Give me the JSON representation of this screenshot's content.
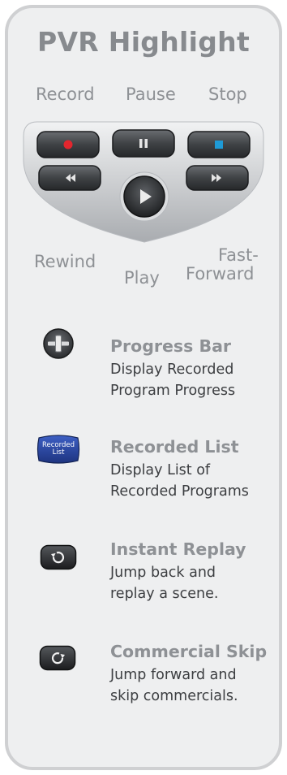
{
  "title": "PVR Highlight",
  "remote": {
    "record_label": "Record",
    "pause_label": "Pause",
    "stop_label": "Stop",
    "rewind_label": "Rewind",
    "play_label": "Play",
    "ff_label_line1": "Fast-",
    "ff_label_line2": "Forward"
  },
  "features": [
    {
      "icon": "progress-bar-button",
      "title": "Progress Bar",
      "desc": [
        "Display Recorded",
        "Program Progress"
      ]
    },
    {
      "icon": "recorded-list-button",
      "icon_text_line1": "Recorded",
      "icon_text_line2": "List",
      "title": "Recorded List",
      "desc": [
        "Display List of",
        "Recorded Programs"
      ]
    },
    {
      "icon": "instant-replay-button",
      "title": "Instant Replay",
      "desc": [
        "Jump back and",
        "replay a scene."
      ]
    },
    {
      "icon": "commercial-skip-button",
      "title": "Commercial Skip",
      "desc": [
        "Jump forward and",
        "skip commercials."
      ]
    }
  ],
  "colors": {
    "record": "#e3262e",
    "stop": "#1e9ad6",
    "recorded_list": "#2c4aa6",
    "heading": "#878a8e"
  }
}
